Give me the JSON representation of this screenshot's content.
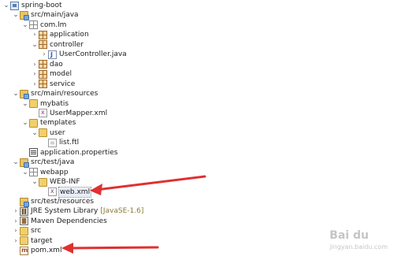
{
  "tree": [
    {
      "label": "spring-boot",
      "indent": 0,
      "toggle": "open",
      "icon": "project"
    },
    {
      "label": "src/main/java",
      "indent": 1,
      "toggle": "open",
      "icon": "srcfolder"
    },
    {
      "label": "com.lm",
      "indent": 2,
      "toggle": "open",
      "icon": "package-empty"
    },
    {
      "label": "application",
      "indent": 3,
      "toggle": "closed",
      "icon": "package"
    },
    {
      "label": "controller",
      "indent": 3,
      "toggle": "open",
      "icon": "package"
    },
    {
      "label": "UserController.java",
      "indent": 4,
      "toggle": "closed",
      "icon": "java"
    },
    {
      "label": "dao",
      "indent": 3,
      "toggle": "closed",
      "icon": "package"
    },
    {
      "label": "model",
      "indent": 3,
      "toggle": "closed",
      "icon": "package"
    },
    {
      "label": "service",
      "indent": 3,
      "toggle": "closed",
      "icon": "package"
    },
    {
      "label": "src/main/resources",
      "indent": 1,
      "toggle": "open",
      "icon": "srcfolder"
    },
    {
      "label": "mybatis",
      "indent": 2,
      "toggle": "open",
      "icon": "folder"
    },
    {
      "label": "UserMapper.xml",
      "indent": 3,
      "toggle": "none",
      "icon": "xml"
    },
    {
      "label": "templates",
      "indent": 2,
      "toggle": "open",
      "icon": "folder"
    },
    {
      "label": "user",
      "indent": 3,
      "toggle": "open",
      "icon": "folder"
    },
    {
      "label": "list.ftl",
      "indent": 4,
      "toggle": "none",
      "icon": "file"
    },
    {
      "label": "application.properties",
      "indent": 2,
      "toggle": "none",
      "icon": "props"
    },
    {
      "label": "src/test/java",
      "indent": 1,
      "toggle": "open",
      "icon": "srcfolder"
    },
    {
      "label": "webapp",
      "indent": 2,
      "toggle": "open",
      "icon": "package-empty"
    },
    {
      "label": "WEB-INF",
      "indent": 3,
      "toggle": "open",
      "icon": "folder"
    },
    {
      "label": "web.xml",
      "indent": 4,
      "toggle": "none",
      "icon": "xml",
      "selected": true
    },
    {
      "label": "src/test/resources",
      "indent": 1,
      "toggle": "none",
      "icon": "srcfolder"
    },
    {
      "label": "JRE System Library",
      "decoration": "[JavaSE-1.6]",
      "indent": 1,
      "toggle": "closed",
      "icon": "library"
    },
    {
      "label": "Maven Dependencies",
      "indent": 1,
      "toggle": "closed",
      "icon": "maven"
    },
    {
      "label": "src",
      "indent": 1,
      "toggle": "closed",
      "icon": "folder"
    },
    {
      "label": "target",
      "indent": 1,
      "toggle": "closed",
      "icon": "folder"
    },
    {
      "label": "pom.xml",
      "indent": 1,
      "toggle": "none",
      "icon": "pom"
    }
  ],
  "annotations": {
    "arrow_color": "#e03030"
  },
  "watermark": {
    "brand": "Bai du",
    "sub": "jingyan.baidu.com"
  }
}
